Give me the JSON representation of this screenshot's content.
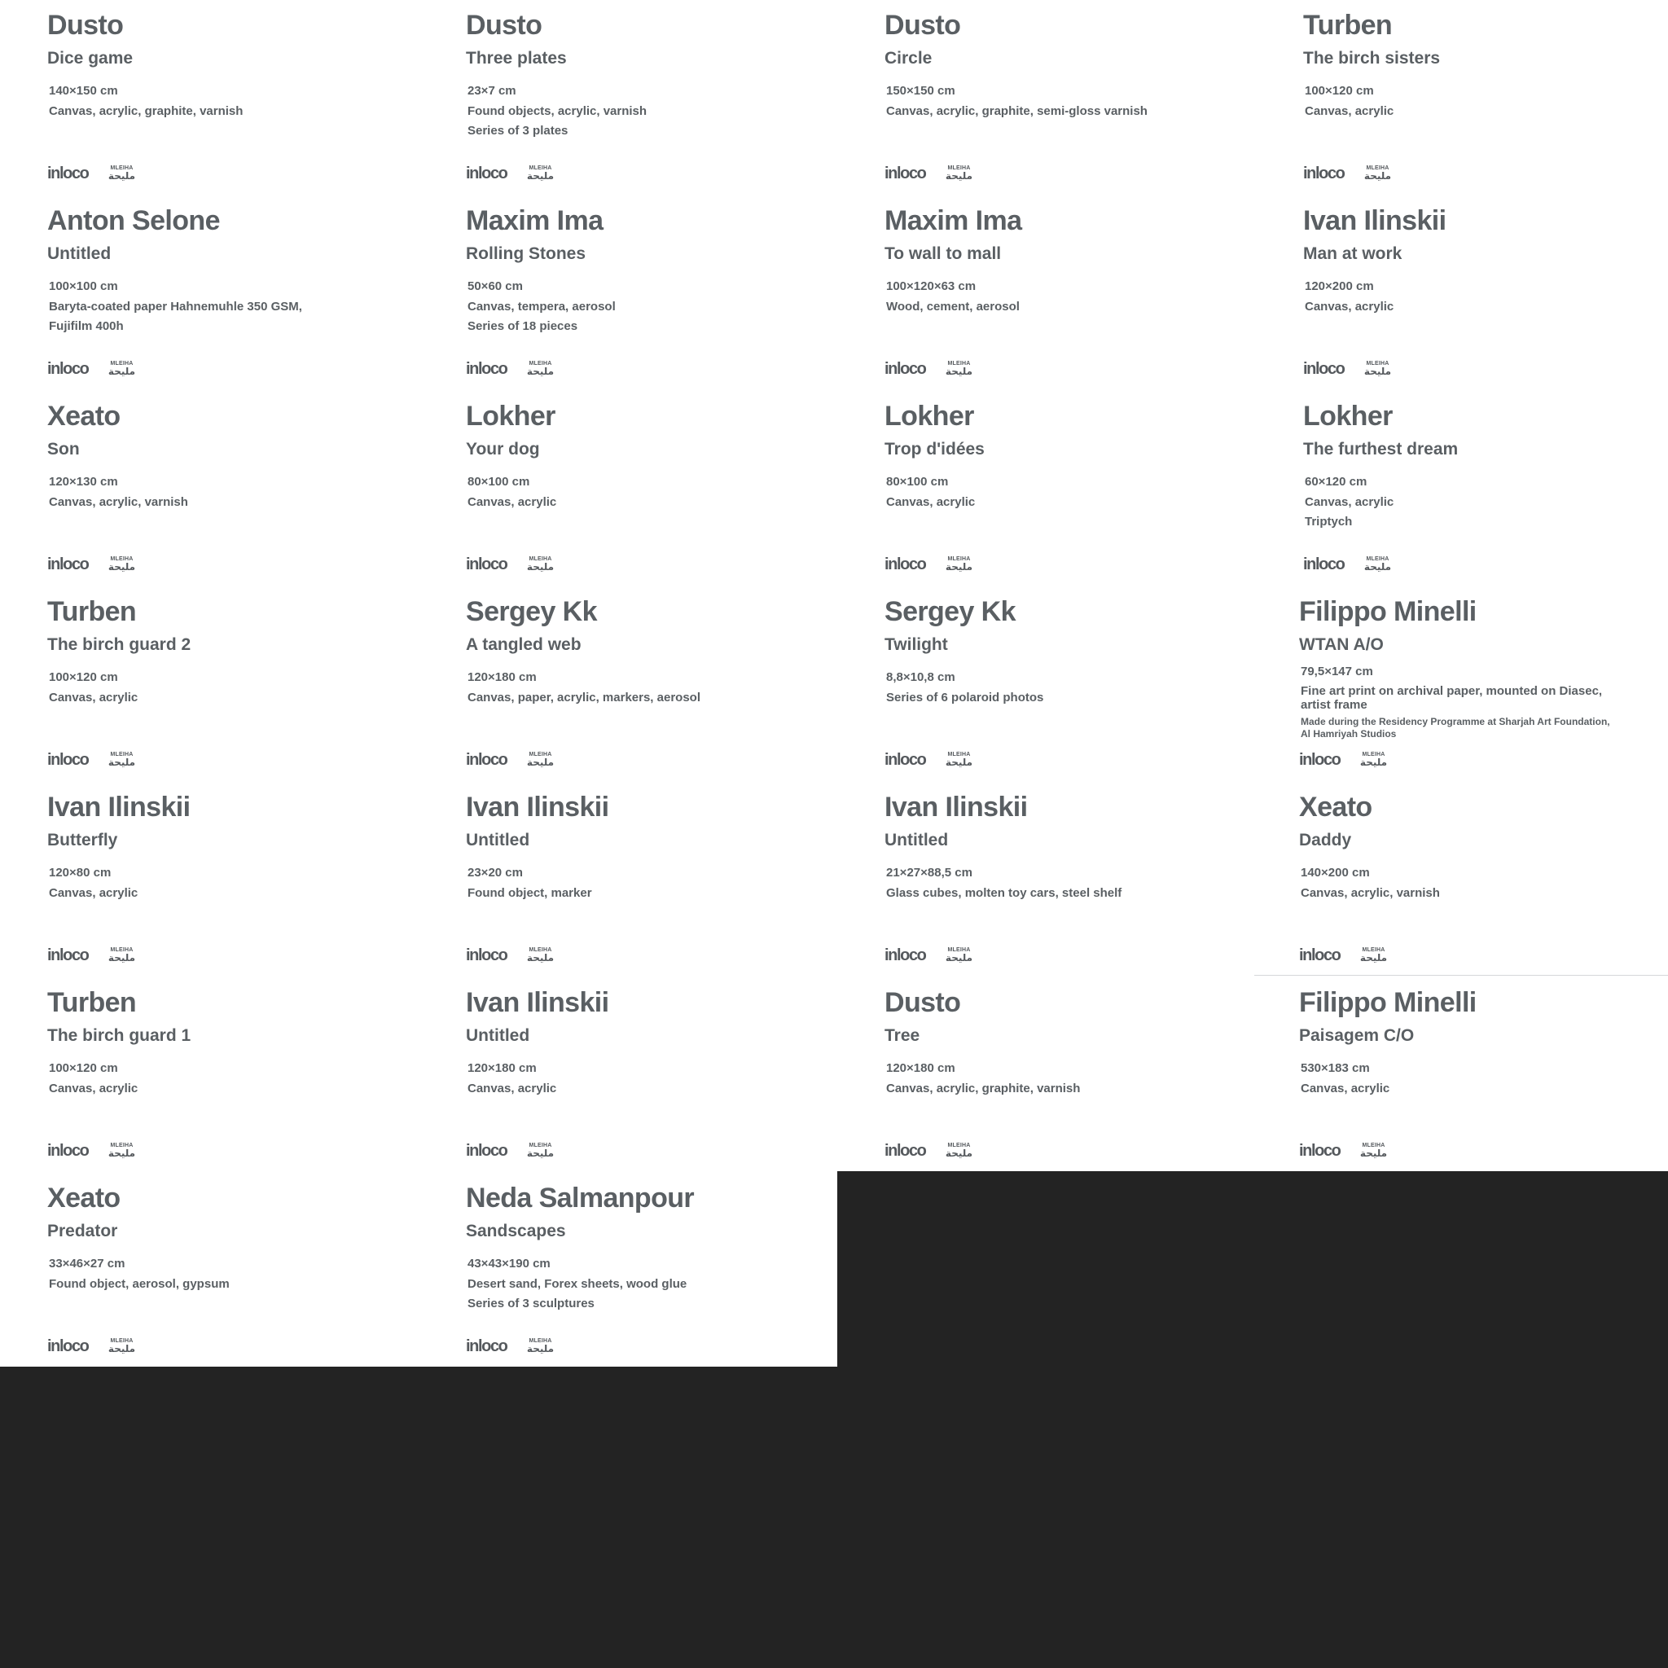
{
  "brand": {
    "inloco": "inloco",
    "maleiha_latin": "MLEIHA",
    "maleiha_arabic": "مليحة"
  },
  "labels": [
    {
      "artist": "Dusto",
      "title": "Dice game",
      "lines": [
        "140×150 cm",
        "Canvas, acrylic, graphite, varnish"
      ]
    },
    {
      "artist": "Dusto",
      "title": "Three plates",
      "lines": [
        "23×7 cm",
        "Found objects, acrylic, varnish",
        "Series of 3 plates"
      ]
    },
    {
      "artist": "Dusto",
      "title": "Circle",
      "lines": [
        "150×150 cm",
        "Canvas, acrylic, graphite, semi-gloss varnish"
      ]
    },
    {
      "artist": "Turben",
      "title": "The birch sisters",
      "lines": [
        "100×120 cm",
        "Canvas, acrylic"
      ]
    },
    {
      "artist": "Anton Selone",
      "title": "Untitled",
      "lines": [
        "100×100 cm",
        "Baryta-coated paper Hahnemuhle 350 GSM,",
        "Fujifilm 400h"
      ]
    },
    {
      "artist": "Maxim Ima",
      "title": "Rolling Stones",
      "lines": [
        "50×60 cm",
        "Canvas, tempera, aerosol",
        "Series of 18 pieces"
      ]
    },
    {
      "artist": "Maxim Ima",
      "title": "To wall to mall",
      "lines": [
        "100×120×63 cm",
        "Wood, cement, aerosol"
      ]
    },
    {
      "artist": "Ivan Ilinskii",
      "title": "Man at work",
      "lines": [
        "120×200 cm",
        "Canvas, acrylic"
      ]
    },
    {
      "artist": "Xeato",
      "title": "Son",
      "lines": [
        "120×130 cm",
        "Canvas, acrylic, varnish"
      ]
    },
    {
      "artist": "Lokher",
      "title": "Your dog",
      "lines": [
        "80×100 cm",
        "Canvas, acrylic"
      ]
    },
    {
      "artist": "Lokher",
      "title": "Trop d'idées",
      "lines": [
        "80×100 cm",
        "Canvas, acrylic"
      ]
    },
    {
      "artist": "Lokher",
      "title": "The furthest dream",
      "lines": [
        "60×120 cm",
        "Canvas, acrylic",
        "Triptych"
      ]
    },
    {
      "artist": "Turben",
      "title": "The birch guard 2",
      "lines": [
        "100×120 cm",
        "Canvas, acrylic"
      ]
    },
    {
      "artist": "Sergey Kk",
      "title": "A tangled web",
      "lines": [
        "120×180 cm",
        "Canvas, paper, acrylic, markers, aerosol"
      ]
    },
    {
      "artist": "Sergey Kk",
      "title": "Twilight",
      "lines": [
        "8,8×10,8 cm",
        "Series of 6 polaroid photos"
      ]
    },
    {
      "artist": "Filippo Minelli",
      "title": "WTAN A/O",
      "size": "79,5×147 cm",
      "medium": [
        "Fine art print on archival paper, mounted on Diasec,",
        "artist frame"
      ],
      "note": [
        "Made during the Residency Programme at Sharjah Art Foundation,",
        "Al Hamriyah Studios"
      ]
    },
    {
      "artist": "Ivan Ilinskii",
      "title": "Butterfly",
      "lines": [
        "120×80 cm",
        "Canvas, acrylic"
      ]
    },
    {
      "artist": "Ivan Ilinskii",
      "title": "Untitled",
      "lines": [
        "23×20 cm",
        "Found object, marker"
      ]
    },
    {
      "artist": "Ivan Ilinskii",
      "title": "Untitled",
      "lines": [
        "21×27×88,5 cm",
        "Glass cubes, molten toy cars, steel shelf"
      ]
    },
    {
      "artist": "Xeato",
      "title": "Daddy",
      "lines": [
        "140×200 cm",
        "Canvas, acrylic, varnish"
      ]
    },
    {
      "artist": "Turben",
      "title": "The birch guard 1",
      "lines": [
        "100×120 cm",
        "Canvas, acrylic"
      ]
    },
    {
      "artist": "Ivan Ilinskii",
      "title": "Untitled",
      "lines": [
        "120×180 cm",
        "Canvas, acrylic"
      ]
    },
    {
      "artist": "Dusto",
      "title": "Tree",
      "lines": [
        "120×180 cm",
        "Canvas, acrylic, graphite, varnish"
      ]
    },
    {
      "artist": "Filippo Minelli",
      "title": "Paisagem C/O",
      "lines": [
        "530×183 cm",
        "Canvas, acrylic"
      ]
    },
    {
      "artist": "Xeato",
      "title": "Predator",
      "lines": [
        "33×46×27 cm",
        "Found object, aerosol, gypsum"
      ]
    },
    {
      "artist": "Neda Salmanpour",
      "title": "Sandscapes",
      "lines": [
        "43×43×190 cm",
        "Desert sand, Forex sheets, wood glue",
        "Series of 3 sculptures"
      ]
    }
  ]
}
